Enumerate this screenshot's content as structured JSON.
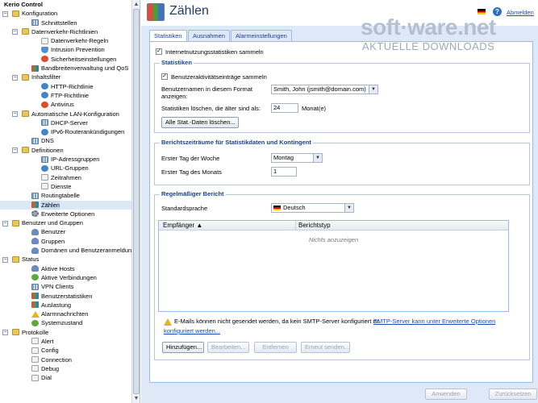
{
  "sidebar": {
    "nodes": [
      {
        "label": "Kerio Control",
        "level": 0,
        "toggle": "",
        "icon": "",
        "root": true
      },
      {
        "label": "Konfiguration",
        "level": 0,
        "toggle": "−",
        "icon": "folder"
      },
      {
        "label": "Schnittstellen",
        "level": 2,
        "toggle": "",
        "icon": "grid"
      },
      {
        "label": "Datenverkehr-Richtlinien",
        "level": 1,
        "toggle": "−",
        "icon": "folder"
      },
      {
        "label": "Datenverkehr-Regeln",
        "level": 3,
        "toggle": "",
        "icon": "page"
      },
      {
        "label": "Intrusion Prevention",
        "level": 3,
        "toggle": "",
        "icon": "shield"
      },
      {
        "label": "Sicherheitseinstellungen",
        "level": 3,
        "toggle": "",
        "icon": "red"
      },
      {
        "label": "Bandbreitenverwaltung und QoS",
        "level": 2,
        "toggle": "",
        "icon": "chart"
      },
      {
        "label": "Inhaltsfilter",
        "level": 1,
        "toggle": "−",
        "icon": "folder"
      },
      {
        "label": "HTTP-Richtlinie",
        "level": 3,
        "toggle": "",
        "icon": "globe"
      },
      {
        "label": "FTP-Richtlinie",
        "level": 3,
        "toggle": "",
        "icon": "globe"
      },
      {
        "label": "Antivirus",
        "level": 3,
        "toggle": "",
        "icon": "red"
      },
      {
        "label": "Automatische LAN-Konfiguration",
        "level": 1,
        "toggle": "−",
        "icon": "folder"
      },
      {
        "label": "DHCP-Server",
        "level": 3,
        "toggle": "",
        "icon": "grid"
      },
      {
        "label": "IPv6-Routerankündigungen",
        "level": 3,
        "toggle": "",
        "icon": "globe"
      },
      {
        "label": "DNS",
        "level": 2,
        "toggle": "",
        "icon": "grid"
      },
      {
        "label": "Definitionen",
        "level": 1,
        "toggle": "−",
        "icon": "folder"
      },
      {
        "label": "IP-Adressgruppen",
        "level": 3,
        "toggle": "",
        "icon": "grid"
      },
      {
        "label": "URL-Gruppen",
        "level": 3,
        "toggle": "",
        "icon": "globe"
      },
      {
        "label": "Zeitrahmen",
        "level": 3,
        "toggle": "",
        "icon": "page"
      },
      {
        "label": "Dienste",
        "level": 3,
        "toggle": "",
        "icon": "page"
      },
      {
        "label": "Routingtabelle",
        "level": 2,
        "toggle": "",
        "icon": "grid"
      },
      {
        "label": "Zählen",
        "level": 2,
        "toggle": "",
        "icon": "chart",
        "selected": true
      },
      {
        "label": "Erweiterte Optionen",
        "level": 2,
        "toggle": "",
        "icon": "gear"
      },
      {
        "label": "Benutzer und Gruppen",
        "level": 0,
        "toggle": "−",
        "icon": "folder"
      },
      {
        "label": "Benutzer",
        "level": 2,
        "toggle": "",
        "icon": "user"
      },
      {
        "label": "Gruppen",
        "level": 2,
        "toggle": "",
        "icon": "user"
      },
      {
        "label": "Domänen und Benutzeranmeldung",
        "level": 2,
        "toggle": "",
        "icon": "user"
      },
      {
        "label": "Status",
        "level": 0,
        "toggle": "−",
        "icon": "folder"
      },
      {
        "label": "Aktive Hosts",
        "level": 2,
        "toggle": "",
        "icon": "user"
      },
      {
        "label": "Aktive Verbindungen",
        "level": 2,
        "toggle": "",
        "icon": "green"
      },
      {
        "label": "VPN Clients",
        "level": 2,
        "toggle": "",
        "icon": "grid"
      },
      {
        "label": "Benutzerstatistiken",
        "level": 2,
        "toggle": "",
        "icon": "chart"
      },
      {
        "label": "Auslastung",
        "level": 2,
        "toggle": "",
        "icon": "chart"
      },
      {
        "label": "Alarmnachrichten",
        "level": 2,
        "toggle": "",
        "icon": "warn"
      },
      {
        "label": "Systemzustand",
        "level": 2,
        "toggle": "",
        "icon": "green"
      },
      {
        "label": "Protokolle",
        "level": 0,
        "toggle": "−",
        "icon": "folder"
      },
      {
        "label": "Alert",
        "level": 2,
        "toggle": "",
        "icon": "page"
      },
      {
        "label": "Config",
        "level": 2,
        "toggle": "",
        "icon": "page"
      },
      {
        "label": "Connection",
        "level": 2,
        "toggle": "",
        "icon": "page"
      },
      {
        "label": "Debug",
        "level": 2,
        "toggle": "",
        "icon": "page"
      },
      {
        "label": "Dial",
        "level": 2,
        "toggle": "",
        "icon": "page"
      }
    ]
  },
  "header": {
    "title": "Zählen",
    "help": "?",
    "logout": "Abmelden"
  },
  "watermark": {
    "main": "soft·ware.net",
    "sub": "AKTUELLE DOWNLOADS"
  },
  "tabs": [
    "Statistiken",
    "Ausnahmen",
    "Alarmeinstellungen"
  ],
  "form": {
    "collect_label": "Internetnutzungsstatistiken sammeln",
    "stats": {
      "legend": "Statistiken",
      "user_activity_label": "Benutzeraktivitätseinträge sammeln",
      "username_format_label_1": "Benutzernamen in diesem Format",
      "username_format_label_2": "anzeigen:",
      "username_format_value": "Smith, John (jsmith@domain.com)",
      "delete_older_label": "Statistiken löschen, die älter sind als:",
      "delete_older_value": "24",
      "delete_older_unit": "Monat(e)",
      "delete_all_button": "Alle Stat.-Daten löschen..."
    },
    "periods": {
      "legend": "Berichtszeiträume für Statistikdaten und Kontingent",
      "first_day_week_label": "Erster Tag der Woche",
      "first_day_week_value": "Montag",
      "first_day_month_label": "Erster Tag des Monats",
      "first_day_month_value": "1"
    },
    "report": {
      "legend": "Regelmäßiger Bericht",
      "language_label": "Standardsprache",
      "language_value": "Deutsch",
      "col_recipient": "Empfänger ▲",
      "col_type": "Berichtstyp",
      "empty_text": "Nichts anzuzeigen",
      "warning_text": "E-Mails können nicht gesendet werden, da kein SMTP-Server konfiguriert ist.",
      "warning_link_1": "SMTP-Server kann unter Erweiterte Optionen",
      "warning_link_2": "konfiguriert werden...",
      "btn_add": "Hinzufügen...",
      "btn_edit": "Bearbeiten...",
      "btn_remove": "Entfernen",
      "btn_resend": "Erneut senden..."
    }
  },
  "footer": {
    "apply": "Anwenden",
    "reset": "Zurücksetzen"
  }
}
